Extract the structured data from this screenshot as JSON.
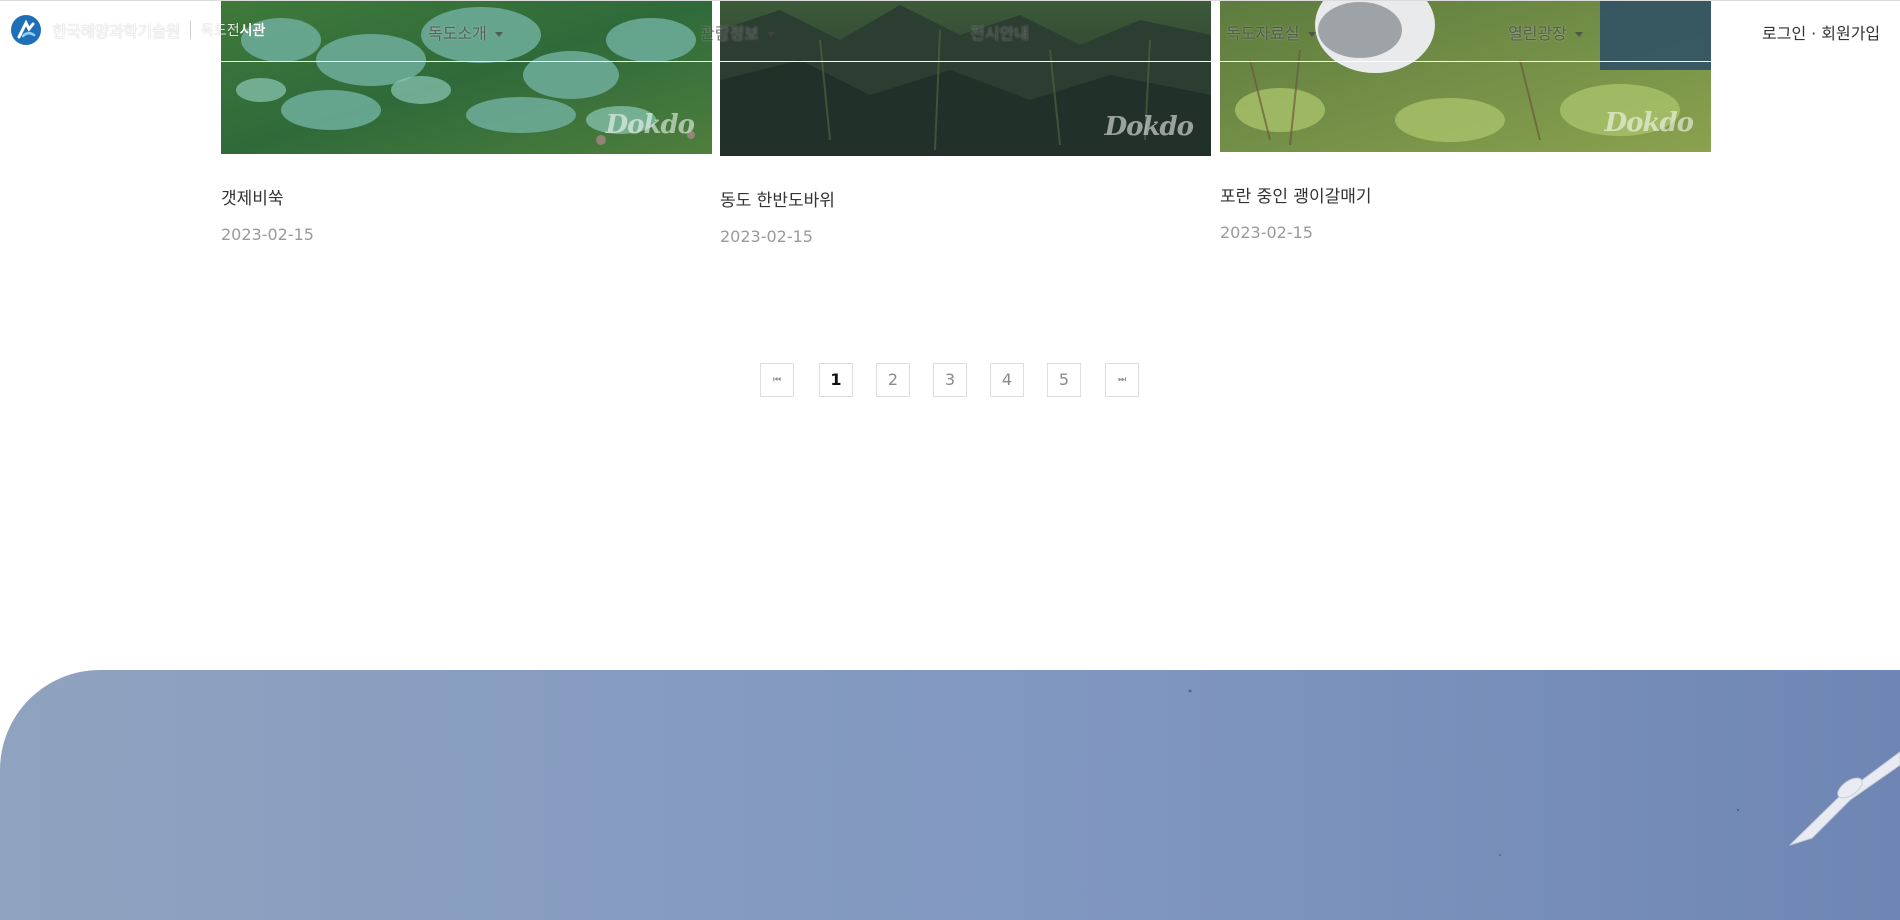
{
  "header": {
    "logo_text": "한국해양과학기술원",
    "logo_sub_light": "독도전",
    "logo_sub_bold": "시관",
    "nav": [
      {
        "label": "독도소개",
        "has_caret": true
      },
      {
        "label": "관람정보",
        "has_caret": true
      },
      {
        "label": "전시안내",
        "has_caret": false
      },
      {
        "label": "독도자료실",
        "has_caret": true
      },
      {
        "label": "열린광장",
        "has_caret": true
      }
    ],
    "auth": {
      "login": "로그인",
      "separator": "·",
      "signup": "회원가입"
    }
  },
  "gallery": [
    {
      "title": "갯제비쑥",
      "date": "2023-02-15",
      "watermark": "Dokdo"
    },
    {
      "title": "동도 한반도바위",
      "date": "2023-02-15",
      "watermark": "Dokdo"
    },
    {
      "title": "포란 중인 괭이갈매기",
      "date": "2023-02-15",
      "watermark": "Dokdo"
    }
  ],
  "pagination": {
    "first": "⏮",
    "last": "⏭",
    "pages": [
      "1",
      "2",
      "3",
      "4",
      "5"
    ],
    "current": "1"
  },
  "colors": {
    "sky_start": "#8fa3c0",
    "sky_end": "#6f86b4",
    "page_border": "#dedede",
    "date_text": "#9a9a9a"
  }
}
